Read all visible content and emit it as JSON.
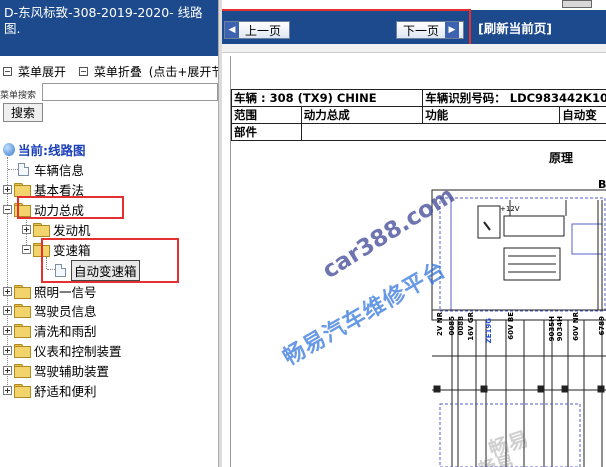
{
  "window": {
    "title": "D-东风标致-308-2019-2020- 线路图."
  },
  "sidebar": {
    "menu_expand": "菜单展开",
    "menu_collapse": "菜单折叠",
    "menu_hint": "(点击+展开节点",
    "search_label": "菜单搜索",
    "search_value": "",
    "search_button": "搜索",
    "tree": {
      "current": "当前:线路图",
      "items": [
        {
          "label": "车辆信息"
        },
        {
          "label": "基本看法"
        },
        {
          "label": "动力总成",
          "children": [
            {
              "label": "发动机"
            },
            {
              "label": "变速箱",
              "children": [
                {
                  "label": "自动变速箱"
                }
              ]
            }
          ]
        },
        {
          "label": "照明一信号"
        },
        {
          "label": "驾驶员信息"
        },
        {
          "label": "清洗和雨刮"
        },
        {
          "label": "仪表和控制装置"
        },
        {
          "label": "驾驶辅助装置"
        },
        {
          "label": "舒适和便利"
        }
      ]
    }
  },
  "nav": {
    "prev_label": "上一页",
    "next_label": "下一页",
    "refresh_label": "[刷新当前页]"
  },
  "document": {
    "row1": {
      "vehicle": "车辆 : 308 (TX9) CHINE",
      "vin": "车辆识别号码： LDC983442K10"
    },
    "row2": {
      "scope": "范围",
      "powertrain": "动力总成",
      "function": "功能",
      "auto": "自动变"
    },
    "row3": {
      "part": "部件"
    },
    "principle": "原理",
    "schematic_labels": {
      "b": "B",
      "v12": "+12V",
      "wires": [
        "2V NR",
        "0085",
        "0088",
        "16V GR",
        "ZE19G",
        "60V BE",
        "9035H",
        "9034H",
        "60V NR",
        "6789"
      ]
    }
  },
  "watermarks": {
    "site": "car388.com",
    "platform": "畅易汽车维修平台",
    "brand1": "畅易",
    "brand2": "畅易"
  },
  "colors": {
    "header_blue": "#1c4a8c",
    "highlight_red": "#e53030",
    "current_blue": "#1a3fb8"
  }
}
